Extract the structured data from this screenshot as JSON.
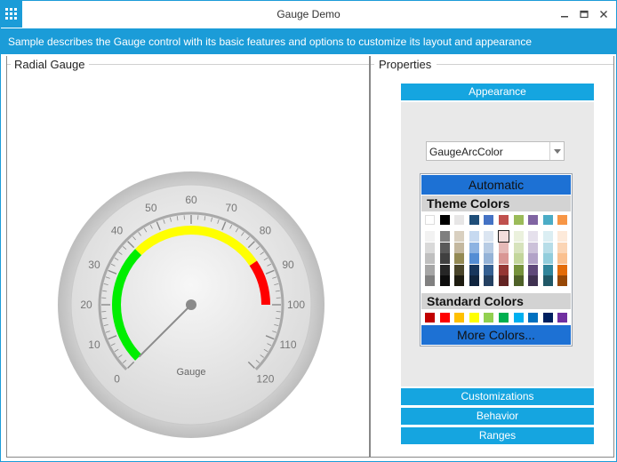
{
  "window": {
    "title": "Gauge Demo",
    "controls": [
      "minimize",
      "maximize",
      "close"
    ]
  },
  "banner": {
    "text": "Sample describes the Gauge control with its basic features and options to customize its layout and appearance"
  },
  "left_panel": {
    "header": "Radial Gauge"
  },
  "gauge": {
    "label": "Gauge",
    "min": 0,
    "max": 120,
    "ticks": [
      "0",
      "10",
      "20",
      "30",
      "40",
      "50",
      "60",
      "70",
      "80",
      "90",
      "100",
      "110",
      "120"
    ],
    "needle_value": 0,
    "ranges": [
      {
        "from": 0,
        "to": 40,
        "color": "#00ee00"
      },
      {
        "from": 40,
        "to": 85,
        "color": "#ffff00"
      },
      {
        "from": 85,
        "to": 100,
        "color": "#ff0000"
      }
    ]
  },
  "right_panel": {
    "header": "Properties",
    "sections": {
      "appearance": "Appearance",
      "customizations": "Customizations",
      "behavior": "Behavior",
      "ranges": "Ranges"
    },
    "combo_value": "GaugeArcColor",
    "picker": {
      "automatic": "Automatic",
      "theme_colors_label": "Theme Colors",
      "standard_colors_label": "Standard Colors",
      "more_colors": "More Colors...",
      "theme_row": [
        "#ffffff",
        "#000000",
        "#e7e6e6",
        "#1f4e79",
        "#4472c4",
        "#c0504d",
        "#9bbb59",
        "#8064a2",
        "#4bacc6",
        "#f79646"
      ],
      "theme_shades": [
        [
          "#f2f2f2",
          "#d9d9d9",
          "#bfbfbf",
          "#a6a6a6",
          "#808080"
        ],
        [
          "#7f7f7f",
          "#595959",
          "#404040",
          "#262626",
          "#0d0d0d"
        ],
        [
          "#d9d0c0",
          "#c4b89f",
          "#948a54",
          "#4a452a",
          "#1d1b10"
        ],
        [
          "#c6d9f0",
          "#8db3e2",
          "#548dd4",
          "#17365d",
          "#0f243e"
        ],
        [
          "#dbe5f1",
          "#b8cce4",
          "#95b3d7",
          "#366092",
          "#244061"
        ],
        [
          "#f2dcdb",
          "#e5b9b7",
          "#d99694",
          "#953734",
          "#632423"
        ],
        [
          "#ebf1dd",
          "#d7e3bc",
          "#c3d69b",
          "#76923c",
          "#4f6128"
        ],
        [
          "#e5e0ec",
          "#ccc1d9",
          "#b2a2c7",
          "#5f497a",
          "#3f3151"
        ],
        [
          "#dbeef3",
          "#b7dde8",
          "#92cddc",
          "#31859b",
          "#205867"
        ],
        [
          "#fdeada",
          "#fbd5b5",
          "#fac08f",
          "#e36c09",
          "#974806"
        ]
      ],
      "standard_row": [
        "#c00000",
        "#ff0000",
        "#ffc000",
        "#ffff00",
        "#92d050",
        "#00b050",
        "#00b0f0",
        "#0070c0",
        "#002060",
        "#7030a0"
      ]
    }
  }
}
